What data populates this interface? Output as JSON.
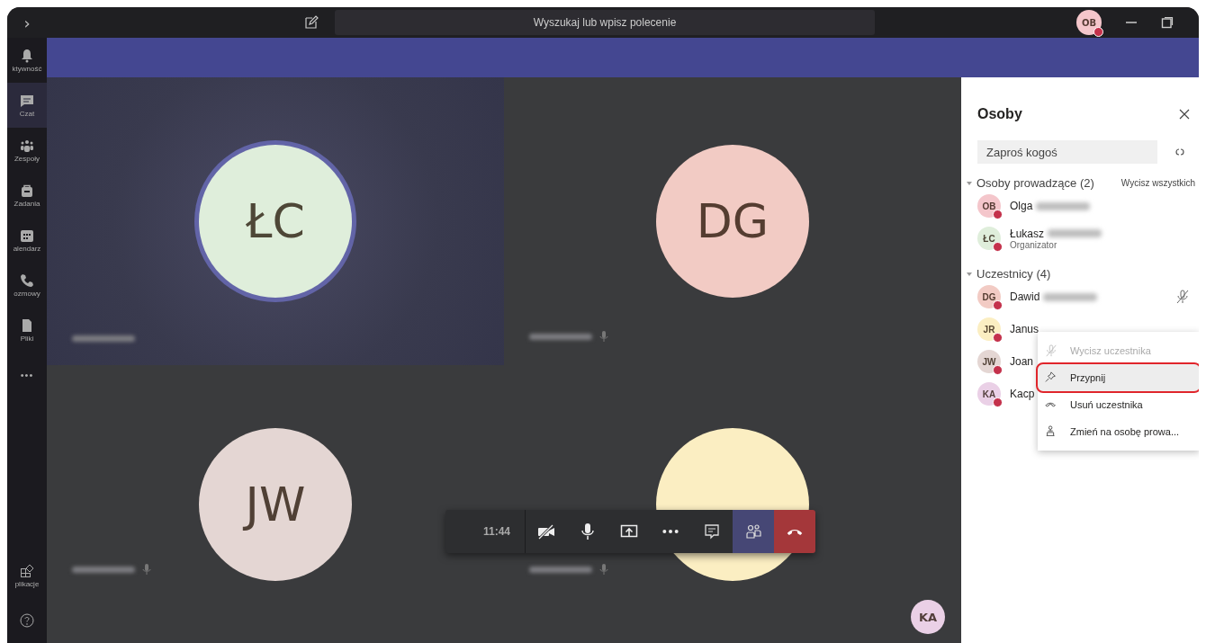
{
  "title_bar": {
    "nav": "›",
    "search_placeholder": "Wyszukaj lub wpisz polecenie",
    "avatar": {
      "initials": "OB",
      "color": "#f4c6cb"
    }
  },
  "rail": {
    "items": [
      {
        "kind": "bell",
        "label": "ktywność",
        "selected": false
      },
      {
        "kind": "chat",
        "label": "Czat",
        "selected": true
      },
      {
        "kind": "teams",
        "label": "Zespoły",
        "selected": false
      },
      {
        "kind": "bag",
        "label": "Zadania",
        "selected": false
      },
      {
        "kind": "calendar",
        "label": "alendarz",
        "selected": false
      },
      {
        "kind": "phone",
        "label": "ozmowy",
        "selected": false
      },
      {
        "kind": "file",
        "label": "Pliki",
        "selected": false
      },
      {
        "kind": "more",
        "label": "•••",
        "selected": false
      }
    ],
    "bottom": [
      {
        "kind": "apps",
        "label": "plikacje",
        "selected": false
      },
      {
        "kind": "help",
        "selected": false
      }
    ]
  },
  "tiles": [
    {
      "initials": "ŁC",
      "color": "#dfeedb",
      "speaking": true,
      "name_blurred": true,
      "mic_shown": false
    },
    {
      "initials": "DG",
      "color": "#f2cbc4",
      "speaking": false,
      "name_blurred": true,
      "mic_shown": true
    },
    {
      "initials": "JW",
      "color": "#e4d6d3",
      "speaking": false,
      "name_blurred": true,
      "mic_shown": true
    },
    {
      "color": "#fbeec2",
      "speaking": false,
      "name_blurred": true,
      "mic_shown": true
    }
  ],
  "self_view": {
    "initials": "KA",
    "color": "#ead0e6"
  },
  "call_bar": {
    "time": "11:44",
    "buttons": [
      {
        "kind": "camera-off",
        "selected": false
      },
      {
        "kind": "mic",
        "selected": false
      },
      {
        "kind": "share",
        "selected": false
      },
      {
        "kind": "more",
        "selected": false
      },
      {
        "kind": "chat",
        "selected": false
      },
      {
        "kind": "people",
        "selected": true
      },
      {
        "kind": "hangup",
        "selected": false
      }
    ]
  },
  "people_panel": {
    "title": "Osoby",
    "invite_placeholder": "Zaproś kogoś",
    "sections": [
      {
        "title": "Osoby prowadzące (2)",
        "expanded": true,
        "action": "Wycisz wszystkich",
        "people": [
          {
            "initials": "OB",
            "color": "#f4c6cb",
            "name": "Olga",
            "surname_blurred": true
          },
          {
            "initials": "ŁC",
            "color": "#dfeedb",
            "name": "Łukasz",
            "subtitle": "Organizator",
            "surname_blurred": true
          }
        ]
      },
      {
        "title": "Uczestnicy (4)",
        "expanded": true,
        "people": [
          {
            "initials": "DG",
            "color": "#f2cbc4",
            "name": "Dawid",
            "surname_blurred": true,
            "muted": true
          },
          {
            "initials": "JR",
            "color": "#fbeec2",
            "name": "Janus"
          },
          {
            "initials": "JW",
            "color": "#e4d6d3",
            "name": "Joan"
          },
          {
            "initials": "KA",
            "color": "#ead0e6",
            "name": "Kacp"
          }
        ]
      }
    ],
    "context_menu": [
      {
        "kind": "mute",
        "label": "Wycisz uczestnika",
        "disabled": true,
        "selected": false,
        "circled": false
      },
      {
        "kind": "pin",
        "label": "Przypnij",
        "disabled": false,
        "selected": true,
        "circled": true
      },
      {
        "kind": "remove",
        "label": "Usuń uczestnika",
        "disabled": false,
        "selected": false,
        "circled": false
      },
      {
        "kind": "presenter",
        "label": "Zmień na osobę prowa...",
        "disabled": false,
        "selected": false,
        "circled": false
      }
    ]
  }
}
